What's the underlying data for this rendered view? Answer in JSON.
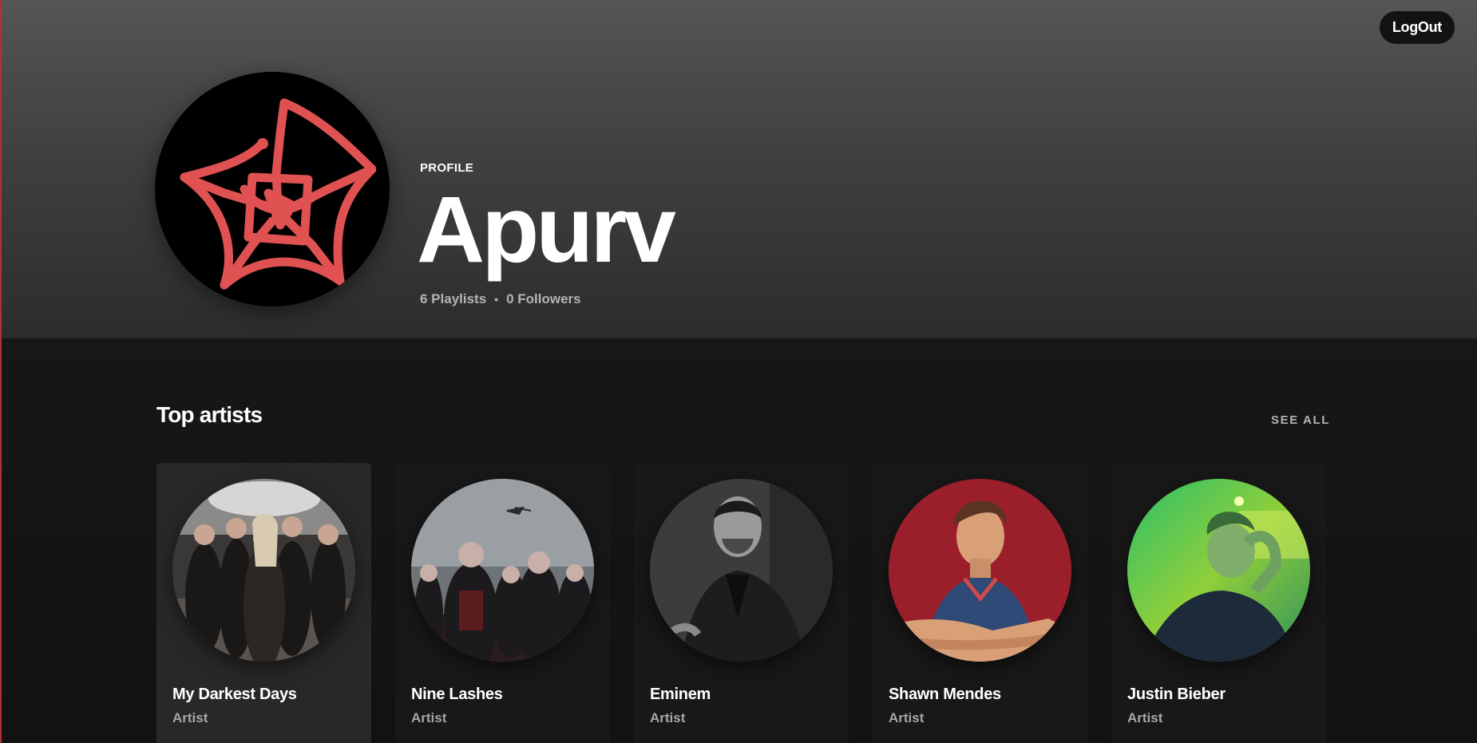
{
  "header": {
    "logout_label": "LogOut",
    "profile_label": "PROFILE",
    "user_name": "Apurv",
    "playlists": "6 Playlists",
    "separator": "•",
    "followers": "0 Followers",
    "avatar_accent": "#e05252"
  },
  "top_artists": {
    "title": "Top artists",
    "see_all": "SEE ALL",
    "artists": [
      {
        "name": "My Darkest Days",
        "type": "Artist"
      },
      {
        "name": "Nine Lashes",
        "type": "Artist"
      },
      {
        "name": "Eminem",
        "type": "Artist"
      },
      {
        "name": "Shawn Mendes",
        "type": "Artist"
      },
      {
        "name": "Justin Bieber",
        "type": "Artist"
      }
    ]
  },
  "colors": {
    "background": "#121212",
    "card": "#181818",
    "card_hover": "#282828",
    "muted_text": "#b3b3b3"
  }
}
